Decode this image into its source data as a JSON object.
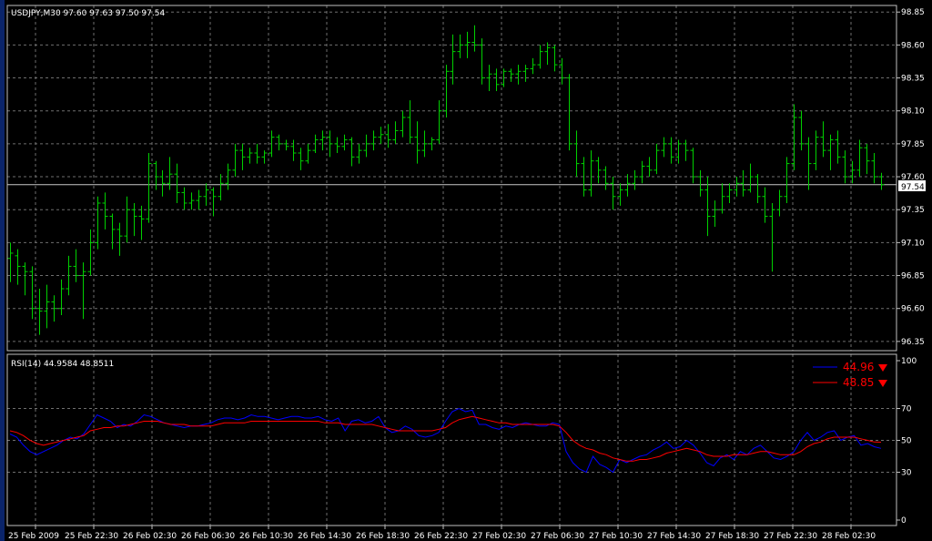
{
  "price_panel": {
    "header": "USDJPY,M30  97.60 97.63 97.50 97.54",
    "current_price_label": "97.54",
    "y_ticks": [
      "98.85",
      "98.60",
      "98.35",
      "98.10",
      "97.85",
      "97.60",
      "97.35",
      "97.10",
      "96.85",
      "96.60",
      "96.35"
    ]
  },
  "rsi_panel": {
    "header": "RSI(14) 44.9584 48.8511",
    "legend": [
      {
        "value": "44.96",
        "color": "#0000ff"
      },
      {
        "value": "48.85",
        "color": "#ff0000"
      }
    ],
    "y_ticks": [
      "100",
      "70",
      "50",
      "30",
      "0"
    ]
  },
  "x_ticks": [
    "25 Feb 2009",
    "25 Feb 22:30",
    "26 Feb 02:30",
    "26 Feb 06:30",
    "26 Feb 10:30",
    "26 Feb 14:30",
    "26 Feb 18:30",
    "26 Feb 22:30",
    "27 Feb 02:30",
    "27 Feb 06:30",
    "27 Feb 10:30",
    "27 Feb 14:30",
    "27 Feb 18:30",
    "27 Feb 22:30",
    "28 Feb 02:30"
  ],
  "colors": {
    "background": "#000000",
    "bar": "#00d000",
    "grid": "#6e6e6e",
    "axis": "#c0c0c0",
    "rsi_line": "#0000ff",
    "signal_line": "#ff0000"
  },
  "chart_data": [
    {
      "type": "ohlc",
      "symbol": "USDJPY",
      "timeframe": "M30",
      "ylim": [
        96.28,
        98.9
      ],
      "bars": [
        [
          96.98,
          97.1,
          96.8,
          97.02
        ],
        [
          97.0,
          97.05,
          96.78,
          96.92
        ],
        [
          96.92,
          96.95,
          96.7,
          96.88
        ],
        [
          96.88,
          96.92,
          96.52,
          96.6
        ],
        [
          96.6,
          96.75,
          96.4,
          96.58
        ],
        [
          96.58,
          96.78,
          96.45,
          96.65
        ],
        [
          96.65,
          96.7,
          96.5,
          96.6
        ],
        [
          96.6,
          96.82,
          96.55,
          96.75
        ],
        [
          96.75,
          97.0,
          96.7,
          96.92
        ],
        [
          96.92,
          97.05,
          96.8,
          96.85
        ],
        [
          96.85,
          96.95,
          96.52,
          96.88
        ],
        [
          96.88,
          97.2,
          96.85,
          97.1
        ],
        [
          97.1,
          97.45,
          97.05,
          97.4
        ],
        [
          97.4,
          97.48,
          97.2,
          97.3
        ],
        [
          97.3,
          97.32,
          97.05,
          97.2
        ],
        [
          97.2,
          97.25,
          97.0,
          97.15
        ],
        [
          97.15,
          97.45,
          97.1,
          97.35
        ],
        [
          97.35,
          97.4,
          97.15,
          97.3
        ],
        [
          97.3,
          97.38,
          97.12,
          97.28
        ],
        [
          97.28,
          97.78,
          97.25,
          97.7
        ],
        [
          97.7,
          97.72,
          97.5,
          97.6
        ],
        [
          97.6,
          97.65,
          97.45,
          97.55
        ],
        [
          97.55,
          97.75,
          97.5,
          97.62
        ],
        [
          97.62,
          97.7,
          97.4,
          97.48
        ],
        [
          97.48,
          97.52,
          97.35,
          97.4
        ],
        [
          97.4,
          97.48,
          97.35,
          97.42
        ],
        [
          97.42,
          97.5,
          97.35,
          97.45
        ],
        [
          97.45,
          97.55,
          97.38,
          97.5
        ],
        [
          97.5,
          97.52,
          97.3,
          97.45
        ],
        [
          97.45,
          97.62,
          97.42,
          97.55
        ],
        [
          97.55,
          97.7,
          97.5,
          97.65
        ],
        [
          97.65,
          97.85,
          97.6,
          97.8
        ],
        [
          97.8,
          97.85,
          97.65,
          97.75
        ],
        [
          97.75,
          97.82,
          97.7,
          97.78
        ],
        [
          97.78,
          97.85,
          97.7,
          97.75
        ],
        [
          97.75,
          97.8,
          97.7,
          97.78
        ],
        [
          97.78,
          97.95,
          97.75,
          97.9
        ],
        [
          97.9,
          97.92,
          97.8,
          97.85
        ],
        [
          97.85,
          97.88,
          97.8,
          97.83
        ],
        [
          97.83,
          97.88,
          97.72,
          97.78
        ],
        [
          97.78,
          97.82,
          97.65,
          97.72
        ],
        [
          97.72,
          97.85,
          97.7,
          97.8
        ],
        [
          97.8,
          97.92,
          97.78,
          97.88
        ],
        [
          97.88,
          97.95,
          97.8,
          97.9
        ],
        [
          97.9,
          97.95,
          97.75,
          97.85
        ],
        [
          97.85,
          97.9,
          97.78,
          97.83
        ],
        [
          97.83,
          97.92,
          97.8,
          97.88
        ],
        [
          97.88,
          97.9,
          97.68,
          97.75
        ],
        [
          97.75,
          97.85,
          97.7,
          97.8
        ],
        [
          97.8,
          97.92,
          97.75,
          97.85
        ],
        [
          97.85,
          97.95,
          97.8,
          97.9
        ],
        [
          97.9,
          97.98,
          97.85,
          97.92
        ],
        [
          97.92,
          98.0,
          97.82,
          97.88
        ],
        [
          97.88,
          98.02,
          97.85,
          97.95
        ],
        [
          97.95,
          98.1,
          97.9,
          98.05
        ],
        [
          98.05,
          98.18,
          97.85,
          97.9
        ],
        [
          97.9,
          98.02,
          97.7,
          97.8
        ],
        [
          97.8,
          97.95,
          97.75,
          97.85
        ],
        [
          97.85,
          97.9,
          97.8,
          97.88
        ],
        [
          97.88,
          98.18,
          97.85,
          98.1
        ],
        [
          98.1,
          98.45,
          98.05,
          98.4
        ],
        [
          98.4,
          98.68,
          98.3,
          98.55
        ],
        [
          98.55,
          98.68,
          98.5,
          98.6
        ],
        [
          98.6,
          98.7,
          98.5,
          98.62
        ],
        [
          98.62,
          98.75,
          98.55,
          98.6
        ],
        [
          98.6,
          98.65,
          98.3,
          98.35
        ],
        [
          98.35,
          98.45,
          98.25,
          98.38
        ],
        [
          98.38,
          98.42,
          98.25,
          98.3
        ],
        [
          98.3,
          98.42,
          98.28,
          98.4
        ],
        [
          98.4,
          98.42,
          98.32,
          98.38
        ],
        [
          98.38,
          98.45,
          98.3,
          98.4
        ],
        [
          98.4,
          98.45,
          98.32,
          98.42
        ],
        [
          98.42,
          98.5,
          98.38,
          98.45
        ],
        [
          98.45,
          98.6,
          98.42,
          98.55
        ],
        [
          98.55,
          98.62,
          98.45,
          98.58
        ],
        [
          98.58,
          98.6,
          98.4,
          98.45
        ],
        [
          98.45,
          98.5,
          98.3,
          98.35
        ],
        [
          98.35,
          98.38,
          97.8,
          97.85
        ],
        [
          97.85,
          97.95,
          97.6,
          97.7
        ],
        [
          97.7,
          97.75,
          97.45,
          97.5
        ],
        [
          97.5,
          97.8,
          97.45,
          97.72
        ],
        [
          97.72,
          97.75,
          97.55,
          97.65
        ],
        [
          97.65,
          97.68,
          97.5,
          97.55
        ],
        [
          97.55,
          97.6,
          97.35,
          97.45
        ],
        [
          97.45,
          97.55,
          97.38,
          97.5
        ],
        [
          97.5,
          97.62,
          97.45,
          97.55
        ],
        [
          97.55,
          97.65,
          97.5,
          97.6
        ],
        [
          97.6,
          97.72,
          97.55,
          97.68
        ],
        [
          97.68,
          97.75,
          97.6,
          97.65
        ],
        [
          97.65,
          97.85,
          97.62,
          97.8
        ],
        [
          97.8,
          97.9,
          97.75,
          97.85
        ],
        [
          97.85,
          97.9,
          97.7,
          97.75
        ],
        [
          97.75,
          97.88,
          97.7,
          97.85
        ],
        [
          97.85,
          97.88,
          97.72,
          97.8
        ],
        [
          97.8,
          97.82,
          97.55,
          97.6
        ],
        [
          97.6,
          97.65,
          97.45,
          97.5
        ],
        [
          97.5,
          97.6,
          97.15,
          97.3
        ],
        [
          97.3,
          97.42,
          97.22,
          97.35
        ],
        [
          97.35,
          97.55,
          97.32,
          97.45
        ],
        [
          97.45,
          97.55,
          97.4,
          97.5
        ],
        [
          97.5,
          97.6,
          97.45,
          97.55
        ],
        [
          97.55,
          97.65,
          97.45,
          97.5
        ],
        [
          97.5,
          97.7,
          97.48,
          97.6
        ],
        [
          97.6,
          97.62,
          97.4,
          97.45
        ],
        [
          97.45,
          97.52,
          97.25,
          97.3
        ],
        [
          97.3,
          97.4,
          96.88,
          97.35
        ],
        [
          97.35,
          97.5,
          97.3,
          97.45
        ],
        [
          97.45,
          97.75,
          97.4,
          97.7
        ],
        [
          97.7,
          98.15,
          97.65,
          98.05
        ],
        [
          98.05,
          98.1,
          97.8,
          97.85
        ],
        [
          97.85,
          97.9,
          97.5,
          97.7
        ],
        [
          97.7,
          97.95,
          97.65,
          97.9
        ],
        [
          97.9,
          98.02,
          97.75,
          97.8
        ],
        [
          97.8,
          97.92,
          97.65,
          97.88
        ],
        [
          97.88,
          97.95,
          97.7,
          97.75
        ],
        [
          97.75,
          97.8,
          97.55,
          97.6
        ],
        [
          97.6,
          97.72,
          97.55,
          97.65
        ],
        [
          97.65,
          97.88,
          97.6,
          97.82
        ],
        [
          97.82,
          97.85,
          97.62,
          97.72
        ],
        [
          97.72,
          97.78,
          97.55,
          97.6
        ],
        [
          97.6,
          97.63,
          97.5,
          97.54
        ]
      ]
    },
    {
      "type": "line",
      "name": "RSI(14)",
      "ylim": [
        0,
        100
      ],
      "series": [
        {
          "name": "44.96",
          "values": [
            54,
            52,
            47,
            43,
            41,
            43,
            45,
            47,
            50,
            52,
            51,
            54,
            60,
            66,
            64,
            62,
            58,
            60,
            59,
            62,
            66,
            65,
            63,
            61,
            60,
            59,
            58,
            59,
            59,
            60,
            61,
            63,
            64,
            64,
            63,
            64,
            66,
            65,
            65,
            64,
            63,
            64,
            65,
            65,
            64,
            64,
            65,
            63,
            62,
            64,
            56,
            62,
            63,
            61,
            62,
            65,
            58,
            55,
            56,
            59,
            57,
            53,
            52,
            53,
            55,
            62,
            68,
            70,
            68,
            69,
            60,
            60,
            58,
            57,
            59,
            58,
            60,
            61,
            60,
            59,
            59,
            61,
            60,
            43,
            36,
            32,
            30,
            40,
            35,
            33,
            30,
            38,
            36,
            38,
            40,
            41,
            44,
            46,
            49,
            45,
            46,
            50,
            47,
            42,
            36,
            34,
            39,
            41,
            38,
            43,
            41,
            45,
            47,
            43,
            39,
            38,
            40,
            43,
            50,
            55,
            50,
            52,
            55,
            56,
            50,
            52,
            53,
            47,
            48,
            46,
            44.96
          ]
        },
        {
          "name": "48.85",
          "values": [
            56,
            55,
            53,
            50,
            48,
            47,
            48,
            49,
            50,
            51,
            52,
            53,
            56,
            57,
            58,
            58,
            59,
            59,
            60,
            61,
            62,
            62,
            62,
            61,
            60,
            60,
            60,
            59,
            59,
            59,
            59,
            60,
            61,
            61,
            61,
            61,
            62,
            62,
            62,
            62,
            62,
            62,
            62,
            62,
            62,
            62,
            62,
            61,
            61,
            61,
            60,
            60,
            60,
            60,
            60,
            59,
            58,
            57,
            56,
            56,
            56,
            56,
            56,
            56,
            57,
            58,
            61,
            63,
            64,
            65,
            64,
            63,
            62,
            61,
            61,
            60,
            60,
            60,
            60,
            60,
            60,
            60,
            59,
            55,
            50,
            47,
            45,
            44,
            42,
            41,
            39,
            38,
            37,
            37,
            38,
            38,
            39,
            40,
            42,
            43,
            44,
            45,
            44,
            43,
            41,
            40,
            40,
            40,
            41,
            41,
            41,
            42,
            43,
            43,
            42,
            41,
            41,
            41,
            43,
            46,
            48,
            49,
            51,
            52,
            52,
            52,
            52,
            51,
            50,
            49,
            48.85
          ]
        }
      ]
    }
  ]
}
